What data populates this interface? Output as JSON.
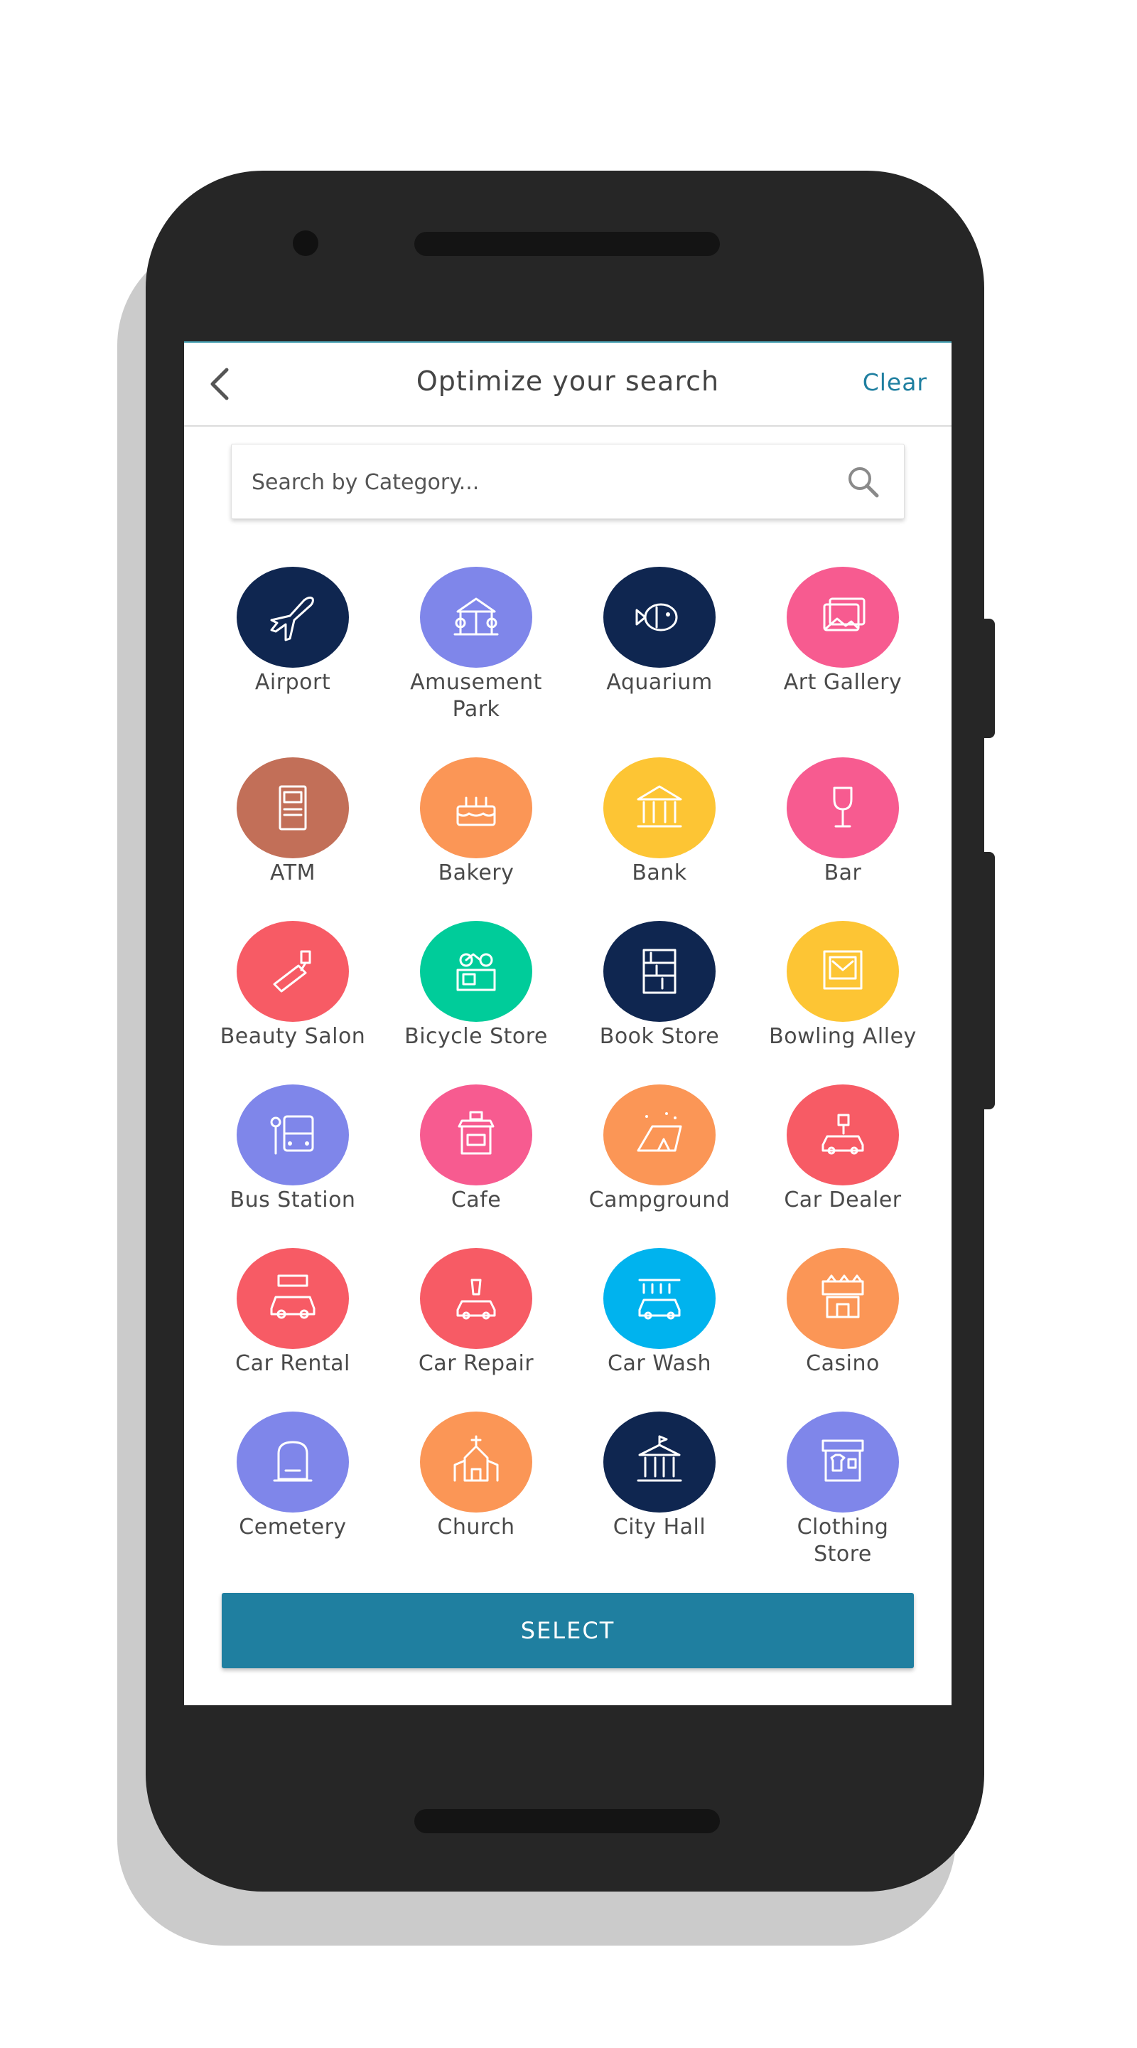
{
  "header": {
    "title": "Optimize your search",
    "clear_label": "Clear"
  },
  "search": {
    "placeholder": "Search by Category..."
  },
  "categories": [
    {
      "label": "Airport",
      "icon": "airplane-icon",
      "color": "#0f2650"
    },
    {
      "label": "Amusement Park",
      "icon": "carousel-icon",
      "color": "#7f86ea"
    },
    {
      "label": "Aquarium",
      "icon": "fish-icon",
      "color": "#0f2650"
    },
    {
      "label": "Art Gallery",
      "icon": "pictures-icon",
      "color": "#f75b90"
    },
    {
      "label": "ATM",
      "icon": "atm-machine-icon",
      "color": "#c26f58"
    },
    {
      "label": "Bakery",
      "icon": "cake-icon",
      "color": "#fb9656"
    },
    {
      "label": "Bank",
      "icon": "bank-building-icon",
      "color": "#fdc534"
    },
    {
      "label": "Bar",
      "icon": "wine-glass-icon",
      "color": "#f75b90"
    },
    {
      "label": "Beauty Salon",
      "icon": "nail-polish-icon",
      "color": "#f75b65"
    },
    {
      "label": "Bicycle Store",
      "icon": "bicycle-shop-icon",
      "color": "#00cc9a"
    },
    {
      "label": "Book Store",
      "icon": "bookshelf-icon",
      "color": "#0f2650"
    },
    {
      "label": "Bowling Alley",
      "icon": "bowling-lane-icon",
      "color": "#fdc534"
    },
    {
      "label": "Bus Station",
      "icon": "bus-stop-icon",
      "color": "#7f86ea"
    },
    {
      "label": "Cafe",
      "icon": "coffee-shop-icon",
      "color": "#f75b90"
    },
    {
      "label": "Campground",
      "icon": "tent-icon",
      "color": "#fb9656"
    },
    {
      "label": "Car Dealer",
      "icon": "car-price-icon",
      "color": "#f75b65"
    },
    {
      "label": "Car Rental",
      "icon": "rent-car-icon",
      "color": "#f75b65"
    },
    {
      "label": "Car Repair",
      "icon": "car-repair-icon",
      "color": "#f75b65"
    },
    {
      "label": "Car Wash",
      "icon": "car-wash-icon",
      "color": "#00b3ee"
    },
    {
      "label": "Casino",
      "icon": "casino-sign-icon",
      "color": "#fb9656"
    },
    {
      "label": "Cemetery",
      "icon": "tombstone-icon",
      "color": "#7f86ea"
    },
    {
      "label": "Church",
      "icon": "church-icon",
      "color": "#fb9656"
    },
    {
      "label": "City Hall",
      "icon": "city-hall-icon",
      "color": "#0f2650"
    },
    {
      "label": "Clothing Store",
      "icon": "clothing-store-icon",
      "color": "#7f86ea"
    }
  ],
  "select_label": "SELECT"
}
